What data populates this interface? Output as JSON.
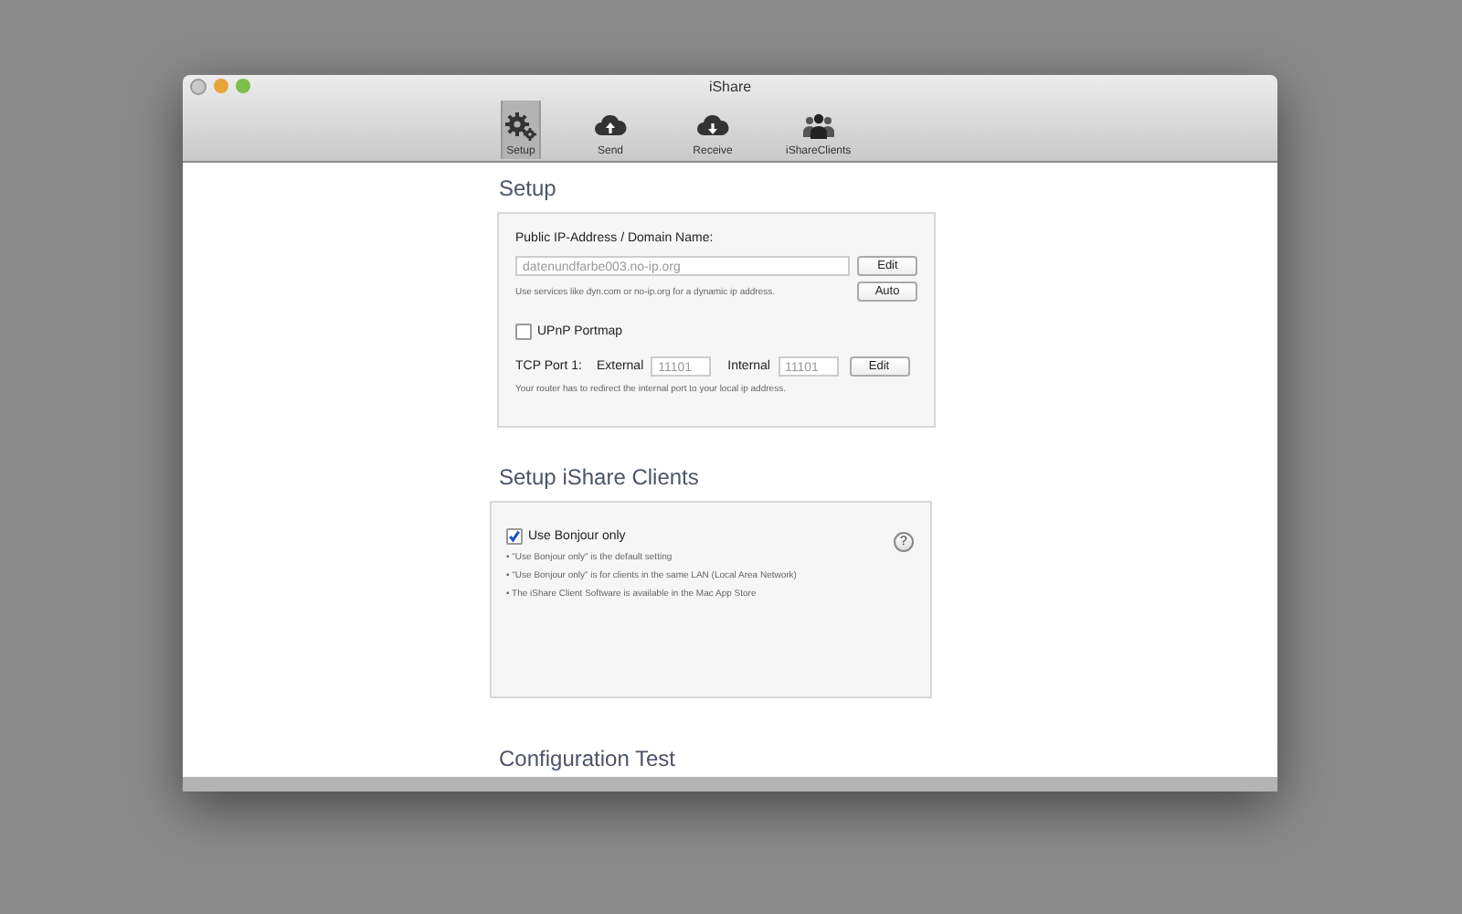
{
  "window": {
    "title": "iShare"
  },
  "toolbar": [
    {
      "label": "Setup",
      "kind": "gears",
      "selected": true
    },
    {
      "label": "Send",
      "kind": "upload",
      "selected": false
    },
    {
      "label": "Receive",
      "kind": "download",
      "selected": false
    },
    {
      "label": "iShareClients",
      "kind": "people",
      "selected": false
    }
  ],
  "setup": {
    "heading": "Setup",
    "address_label": "Public IP-Address / Domain Name:",
    "address_value": "datenundfarbe003.no-ip.org",
    "address_hint": "Use services like dyn.com or no-ip.org for a dynamic ip address.",
    "edit_button": "Edit",
    "auto_button": "Auto",
    "upnp": {
      "label": "UPnP Portmap",
      "checked": false
    },
    "port_label": "TCP Port 1:",
    "external_label": "External",
    "external_value": "11101",
    "internal_label": "Internal",
    "internal_value": "11101",
    "port_edit_button": "Edit",
    "port_hint": "Your router has to redirect the internal port to your local ip address."
  },
  "clients": {
    "heading": "Setup iShare Clients",
    "bonjour": {
      "label": "Use Bonjour only",
      "checked": true
    },
    "help": "?",
    "notes": [
      "• \"Use Bonjour only\" is the default setting",
      "• \"Use Bonjour only\" is for clients in the same LAN (Local Area Network)",
      "• The iShare Client Software is available in the Mac App Store"
    ]
  },
  "config": {
    "heading": "Configuration Test"
  }
}
